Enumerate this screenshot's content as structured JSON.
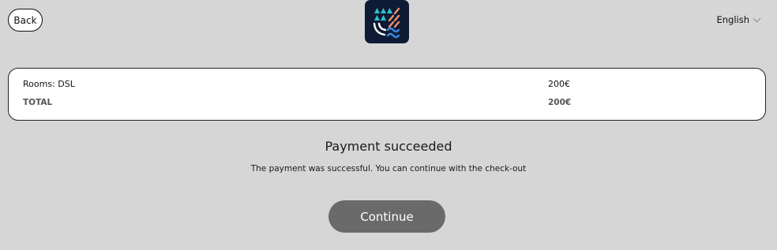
{
  "header": {
    "back_label": "Back",
    "logo_icon": "hotel-wave-logo",
    "language": "English",
    "language_icon": "chevron-down-icon"
  },
  "summary": {
    "items": [
      {
        "name": "Rooms: DSL",
        "amount": "200€"
      }
    ],
    "total_label": "TOTAL",
    "total_amount": "200€"
  },
  "status": {
    "title": "Payment succeeded",
    "message": "The payment was successful. You can continue with the check-out"
  },
  "actions": {
    "continue_label": "Continue"
  },
  "colors": {
    "background": "#d6d6d6",
    "logo_bg": "#0f1b35",
    "logo_teal": "#2fc3c9",
    "logo_orange": "#f0926a",
    "logo_blue": "#3a8ee6",
    "button": "#6a6a6a"
  }
}
